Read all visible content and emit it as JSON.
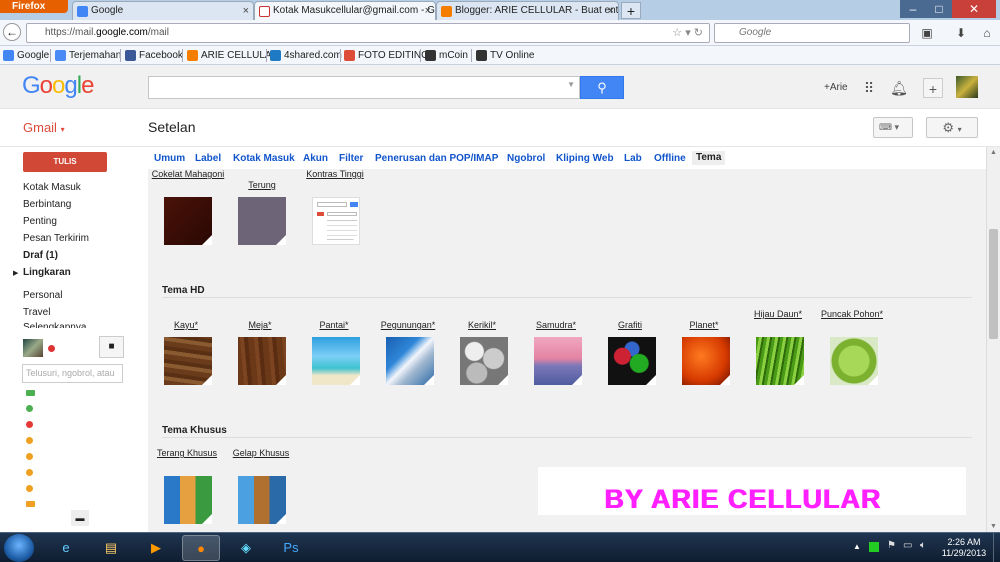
{
  "browser": {
    "app_button": "Firefox",
    "tabs": [
      {
        "label": "Google",
        "active": false
      },
      {
        "label": "Kotak Masukcellular@gmail.com - G...",
        "active": true
      },
      {
        "label": "Blogger: ARIE CELLULAR - Buat entri",
        "active": false
      }
    ],
    "url_prefix": "https://mail.",
    "url_domain": "google.com",
    "url_suffix": "/mail",
    "search_placeholder": "Google"
  },
  "bookmarks": [
    "Google",
    "Terjemahan",
    "Facebook",
    "ARIE CELLULAR",
    "4shared.com",
    "FOTO EDITING",
    "mCoin",
    "TV Online"
  ],
  "gmail": {
    "logo": [
      "G",
      "o",
      "o",
      "g",
      "l",
      "e"
    ],
    "user": "+Arie",
    "product_label": "Gmail",
    "page_title": "Setelan",
    "compose": "TULIS",
    "nav": [
      "Kotak Masuk",
      "Berbintang",
      "Penting",
      "Pesan Terkirim",
      "Draf (1)",
      "Lingkaran",
      "Personal",
      "Travel",
      "Selengkapnya"
    ],
    "chat_search_placeholder": "Telusuri, ngobrol, atau"
  },
  "settings_tabs": [
    "Umum",
    "Label",
    "Kotak Masuk",
    "Akun",
    "Filter",
    "Penerusan dan POP/IMAP",
    "Ngobrol",
    "Kliping Web",
    "Lab",
    "Offline",
    "Tema"
  ],
  "themes_top": [
    {
      "label": "Cokelat Mahagoni"
    },
    {
      "label": "Terung"
    },
    {
      "label": "Kontras Tinggi"
    }
  ],
  "section_hd": "Tema HD",
  "themes_hd": [
    {
      "label": "Kayu*"
    },
    {
      "label": "Meja*"
    },
    {
      "label": "Pantai*"
    },
    {
      "label": "Pegunungan*"
    },
    {
      "label": "Kerikil*"
    },
    {
      "label": "Samudra*"
    },
    {
      "label": "Grafiti"
    },
    {
      "label": "Planet*"
    },
    {
      "label": "Hijau Daun*"
    },
    {
      "label": "Puncak Pohon*"
    }
  ],
  "section_special": "Tema Khusus",
  "themes_special": [
    {
      "label": "Terang Khusus"
    },
    {
      "label": "Gelap Khusus"
    }
  ],
  "watermark": "BY ARIE CELLULAR",
  "taskbar": {
    "time": "2:26 AM",
    "date": "11/29/2013"
  },
  "colors": {
    "gmail_red": "#dd4b39",
    "compose_red": "#d14836",
    "search_blue": "#4285f4",
    "link_blue": "#1155cc",
    "watermark_magenta": "#ff1fff"
  }
}
